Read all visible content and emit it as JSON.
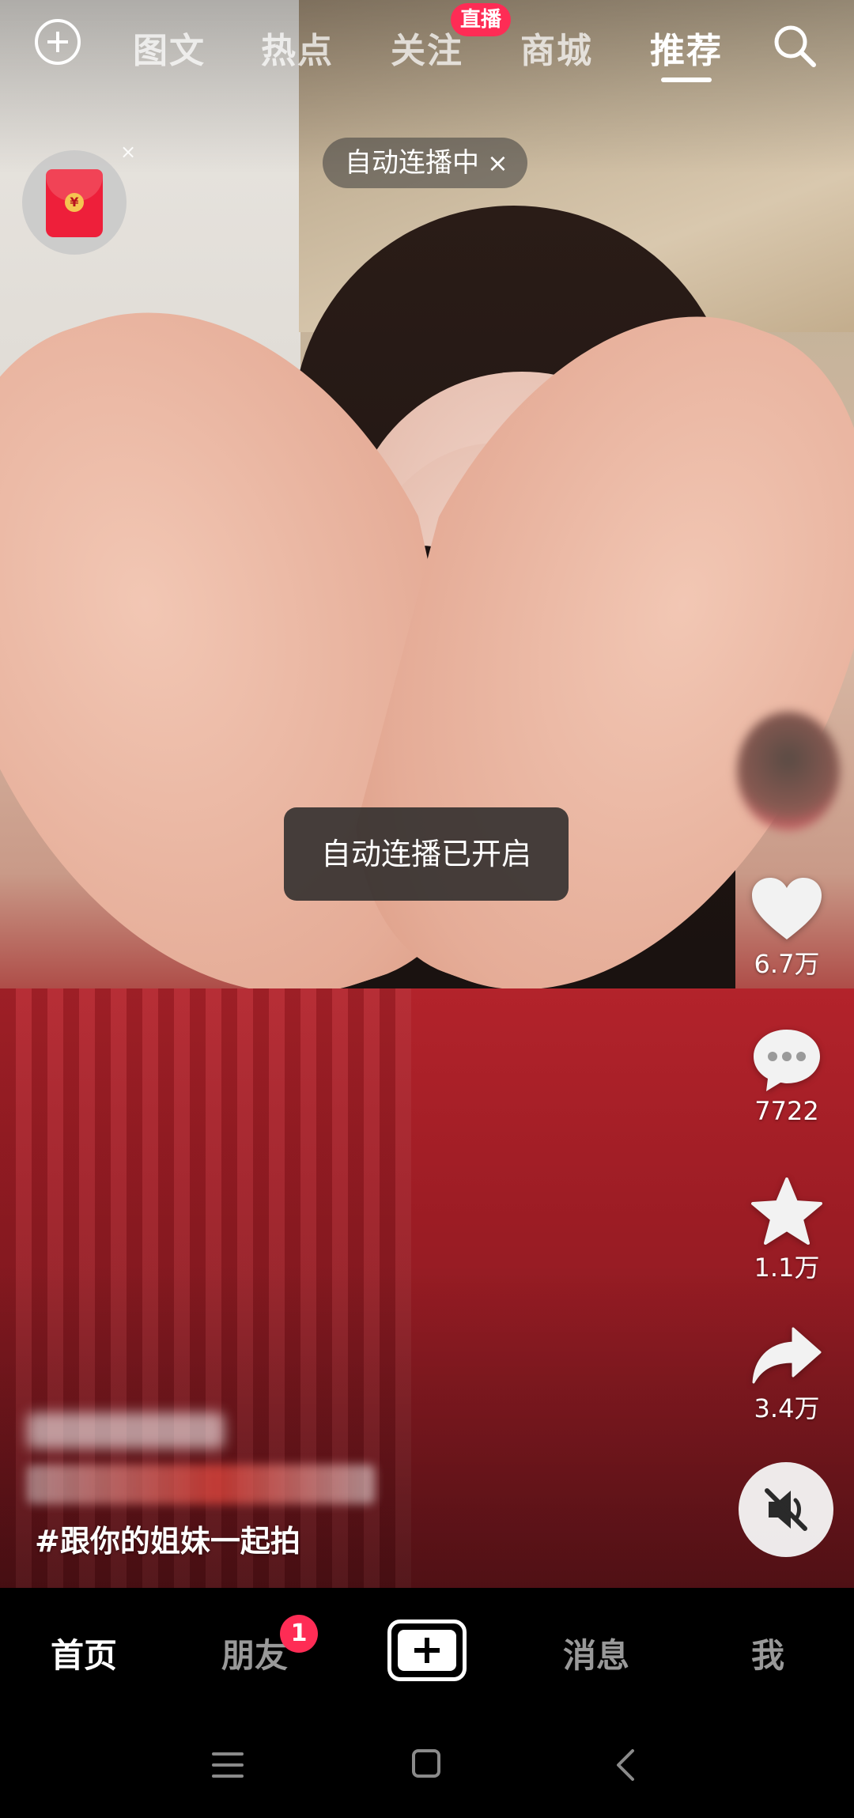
{
  "top_nav": {
    "tabs": [
      "图文",
      "热点",
      "关注",
      "商城",
      "推荐"
    ],
    "active_tab": "推荐",
    "live_badge": "直播"
  },
  "autoplay_chip": {
    "label": "自动连播中",
    "close_symbol": "×"
  },
  "envelope": {
    "seal_symbol": "¥",
    "close_symbol": "×"
  },
  "toast": "自动连播已开启",
  "actions": {
    "likes": "6.7万",
    "comments": "7722",
    "favorites": "1.1万",
    "shares": "3.4万"
  },
  "caption": {
    "hashtag": "#跟你的姐妹一起拍"
  },
  "bottom_tabs": {
    "home": "首页",
    "friends": "朋友",
    "friends_badge": "1",
    "messages": "消息",
    "me": "我"
  },
  "colors": {
    "accent": "#fe2c55",
    "tabbar": "#000000"
  },
  "icons": {
    "top_left": "add-circle-icon",
    "top_right": "search-icon",
    "like": "heart-icon",
    "comment": "comment-bubble-icon",
    "favorite": "star-icon",
    "share": "share-arrow-icon",
    "mute": "speaker-muted-icon",
    "publish": "plus-square-icon",
    "system": [
      "menu-icon",
      "home-square-icon",
      "back-chevron-icon"
    ]
  }
}
